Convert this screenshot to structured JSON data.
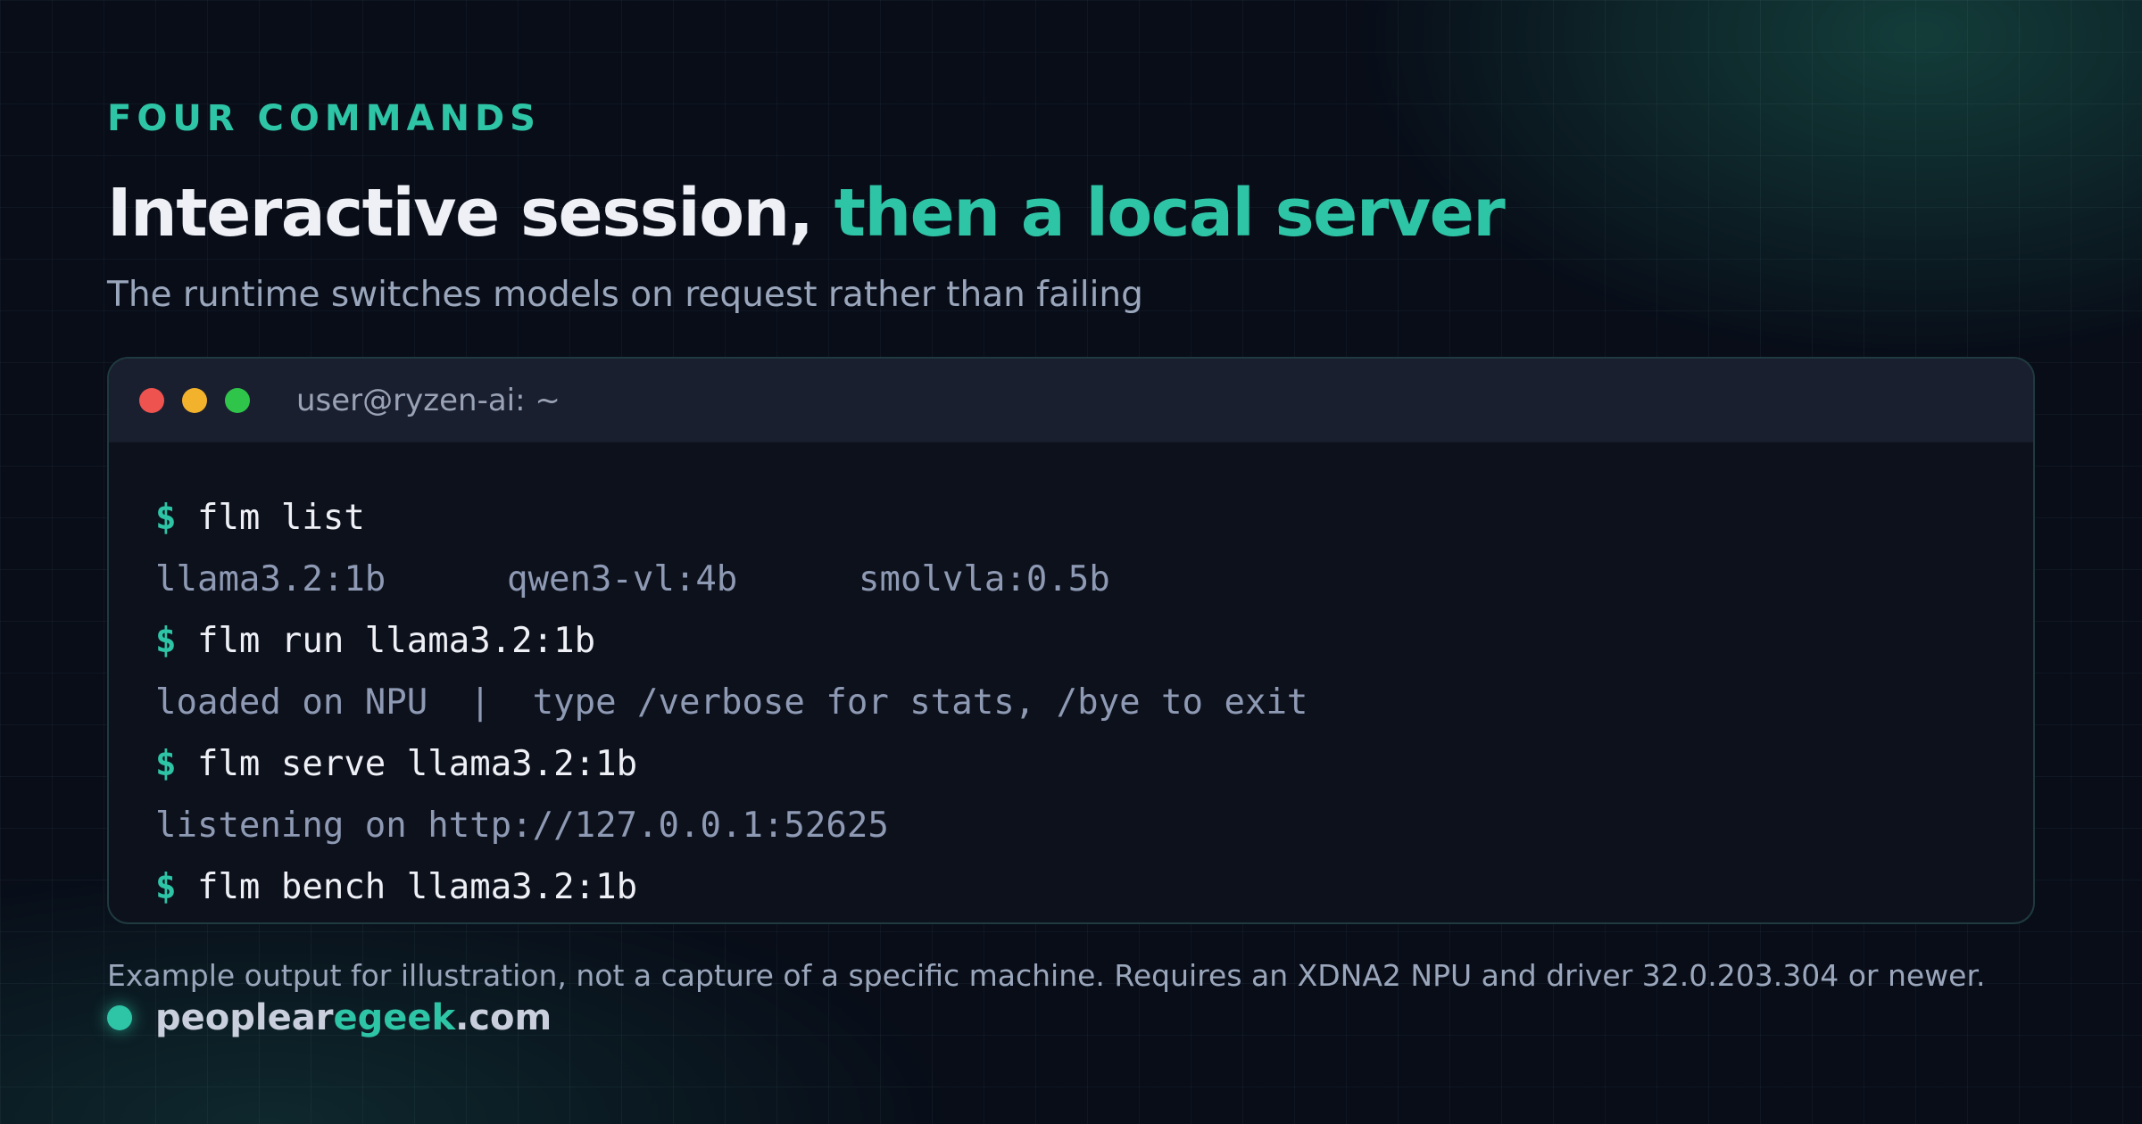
{
  "header": {
    "eyebrow": "FOUR COMMANDS",
    "title_part1": "Interactive session, ",
    "title_part2": "then a local server",
    "subtitle": "The runtime switches models on request rather than failing"
  },
  "terminal": {
    "title": "user@ryzen-ai: ~",
    "prompt_symbol": "$",
    "lines": [
      {
        "type": "command",
        "text": "flm list"
      },
      {
        "type": "output",
        "columns": [
          "llama3.2:1b",
          "qwen3-vl:4b",
          "smolvla:0.5b"
        ]
      },
      {
        "type": "command",
        "text": "flm run llama3.2:1b"
      },
      {
        "type": "output",
        "text": "loaded on NPU  |  type /verbose for stats, /bye to exit"
      },
      {
        "type": "command",
        "text": "flm serve llama3.2:1b"
      },
      {
        "type": "output",
        "text": "listening on http://127.0.0.1:52625"
      },
      {
        "type": "command",
        "text": "flm bench llama3.2:1b"
      }
    ]
  },
  "footer": {
    "note": "Example output for illustration, not a capture of a specific machine. Requires an XDNA2 NPU and driver 32.0.203.304 or newer.",
    "brand_part1": "peoplear",
    "brand_part2": "egeek",
    "brand_part3": ".com"
  },
  "colors": {
    "accent": "#2ec4a6",
    "background": "#080d18",
    "terminal_bg": "#0d111c",
    "traffic_red": "#ef5350",
    "traffic_yellow": "#f3b22c",
    "traffic_green": "#2fc54a"
  },
  "icons": {
    "window_controls": [
      "close-dot",
      "minimize-dot",
      "maximize-dot"
    ],
    "brand_mark": "dot"
  }
}
